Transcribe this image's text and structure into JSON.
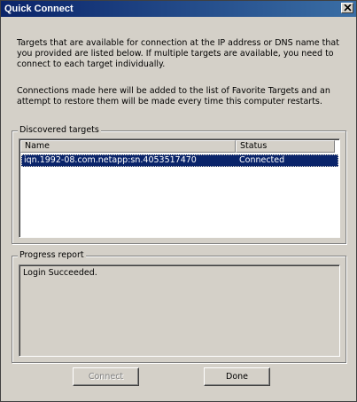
{
  "window": {
    "title": "Quick Connect"
  },
  "intro": {
    "paragraph1": "Targets that are available for connection at the IP address or DNS name that you provided are listed below.  If multiple targets are available, you need to connect to each target individually.",
    "paragraph2": "Connections made here will be added to the list of Favorite Targets and an attempt to restore them will be made every time this computer restarts."
  },
  "discovered": {
    "group_label": "Discovered targets",
    "columns": [
      "Name",
      "Status"
    ],
    "rows": [
      {
        "name": "iqn.1992-08.com.netapp:sn.4053517470",
        "status": "Connected"
      }
    ]
  },
  "progress": {
    "group_label": "Progress report",
    "text": "Login Succeeded."
  },
  "buttons": {
    "connect": "Connect",
    "done": "Done"
  },
  "icons": {
    "close": "close-icon"
  }
}
